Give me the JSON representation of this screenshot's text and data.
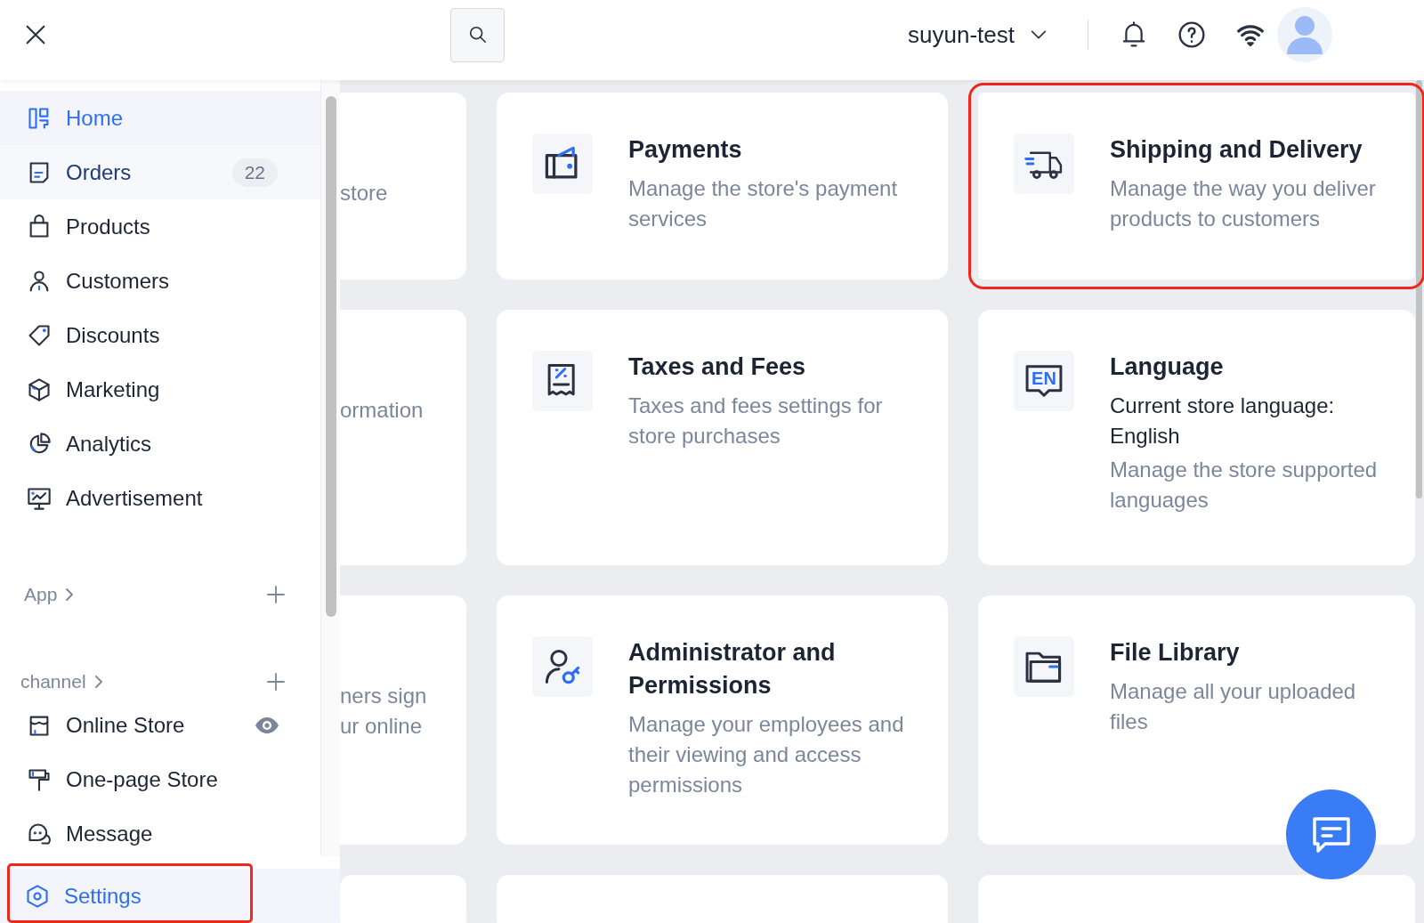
{
  "header": {
    "account": "suyun-test"
  },
  "sidebar": {
    "items": [
      {
        "label": "Home",
        "selected": true,
        "hovered": false
      },
      {
        "label": "Orders",
        "selected": false,
        "hovered": true,
        "badge": "22"
      },
      {
        "label": "Products",
        "selected": false,
        "hovered": false
      },
      {
        "label": "Customers",
        "selected": false,
        "hovered": false
      },
      {
        "label": "Discounts",
        "selected": false,
        "hovered": false
      },
      {
        "label": "Marketing",
        "selected": false,
        "hovered": false
      },
      {
        "label": "Analytics",
        "selected": false,
        "hovered": false
      },
      {
        "label": "Advertisement",
        "selected": false,
        "hovered": false
      }
    ],
    "sections": [
      {
        "label": "App"
      },
      {
        "label": "channel",
        "items": [
          {
            "label": "Online Store",
            "selected": false,
            "hovered": false,
            "preview": true
          },
          {
            "label": "One-page Store",
            "selected": false,
            "hovered": false
          },
          {
            "label": "Message",
            "selected": false,
            "hovered": false
          }
        ]
      }
    ],
    "settings": {
      "label": "Settings",
      "selected": true,
      "annotated": true
    }
  },
  "cards": [
    {
      "kind": "partial",
      "lines": [
        "store"
      ]
    },
    {
      "kind": "setting",
      "title": "Payments",
      "description": "Manage the store's payment services",
      "annotated": false
    },
    {
      "kind": "setting",
      "title": "Shipping and Delivery",
      "description": "Manage the way you deliver products to customers",
      "annotated": true
    },
    {
      "kind": "partial",
      "lines": [
        "ormation"
      ]
    },
    {
      "kind": "setting",
      "title": "Taxes and Fees",
      "description": "Taxes and fees settings for store purchases",
      "annotated": false
    },
    {
      "kind": "setting",
      "title": "Language",
      "icon_label": "EN",
      "value": "Current store language: English",
      "description": "Manage the store supported languages",
      "annotated": false
    },
    {
      "kind": "partial",
      "lines": [
        "ners sign",
        "ur online"
      ]
    },
    {
      "kind": "setting",
      "title": "Administrator and Permissions",
      "description": "Manage your employees and their viewing and access permissions",
      "annotated": false
    },
    {
      "kind": "setting",
      "title": "File Library",
      "description": "Manage all your uploaded files",
      "annotated": false
    },
    {
      "kind": "empty"
    },
    {
      "kind": "empty"
    },
    {
      "kind": "empty"
    }
  ]
}
